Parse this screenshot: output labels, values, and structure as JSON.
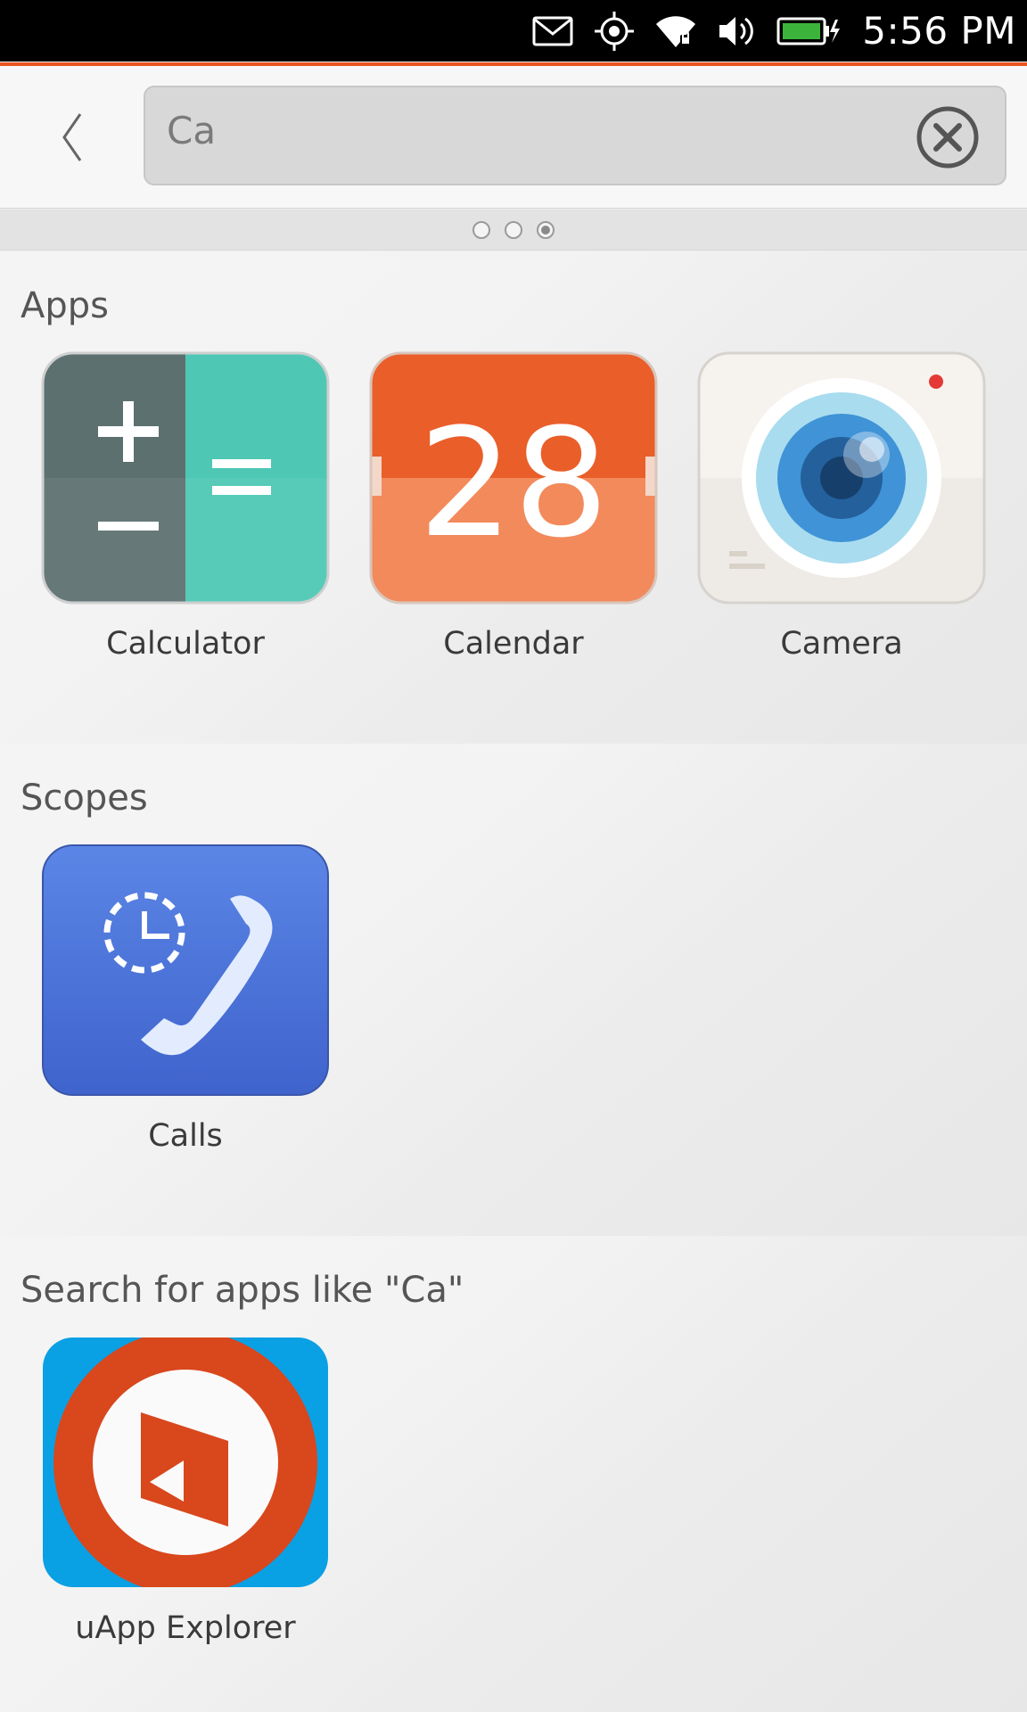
{
  "status_bar": {
    "time": "5:56 PM",
    "icons": [
      "mail-icon",
      "location-icon",
      "wifi-icon",
      "volume-icon",
      "battery-charging-icon"
    ]
  },
  "header": {
    "back_icon": "chevron-left-icon",
    "search": {
      "value": "Ca",
      "clear_icon": "clear-circle-icon"
    }
  },
  "page_indicator": {
    "count": 3,
    "active_index": 2
  },
  "sections": {
    "apps": {
      "title": "Apps",
      "items": [
        {
          "label": "Calculator",
          "icon": "calculator-app-icon"
        },
        {
          "label": "Calendar",
          "icon": "calendar-app-icon",
          "icon_text": "28"
        },
        {
          "label": "Camera",
          "icon": "camera-app-icon"
        }
      ]
    },
    "scopes": {
      "title": "Scopes",
      "items": [
        {
          "label": "Calls",
          "icon": "calls-scope-icon"
        }
      ]
    },
    "search_more": {
      "title": "Search for apps like \"Ca\"",
      "items": [
        {
          "label": "uApp Explorer",
          "icon": "uapp-explorer-icon"
        }
      ]
    }
  },
  "colors": {
    "accent": "#e95420",
    "calculator_dark": "#5d7070",
    "calculator_teal": "#4ec8b4",
    "calendar_orange": "#ee6a35",
    "calls_blue": "#4a6fd6",
    "uapp_blue": "#0aa0e4",
    "uapp_red": "#d9471c"
  }
}
